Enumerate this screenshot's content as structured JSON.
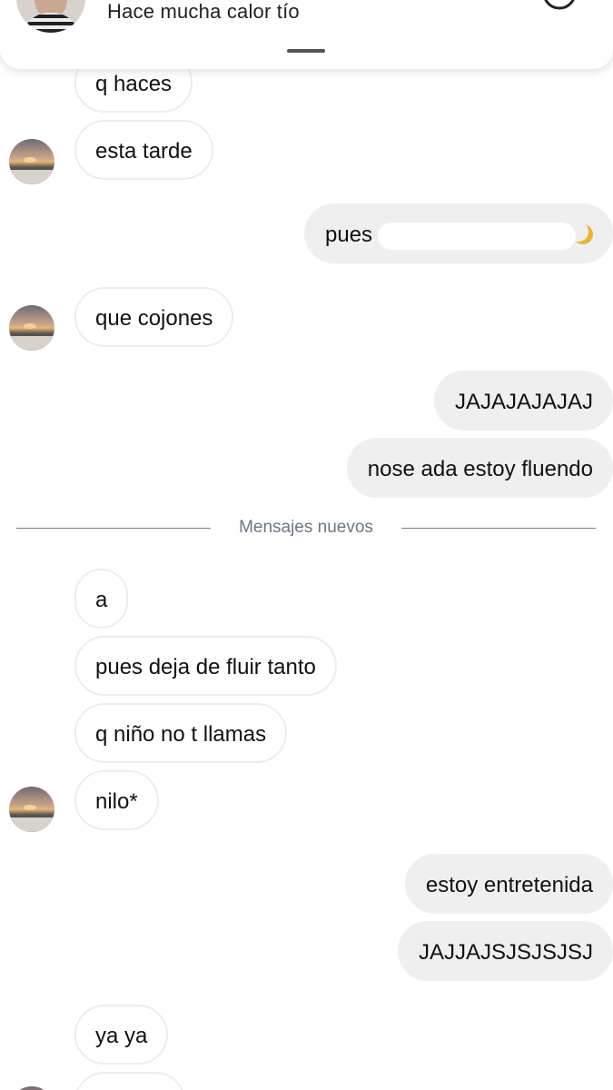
{
  "header": {
    "subtitle": "Hace mucha calor tío"
  },
  "divider": {
    "label": "Mensajes nuevos"
  },
  "messages": [
    {
      "side": "in",
      "text": "q haces"
    },
    {
      "side": "in",
      "text": "esta tarde"
    },
    {
      "side": "out",
      "text": "pues"
    },
    {
      "side": "in",
      "text": "que cojones"
    },
    {
      "side": "out",
      "text": "JAJAJAJAJAJ"
    },
    {
      "side": "out",
      "text": "nose ada estoy fluendo"
    },
    {
      "side": "in",
      "text": "a"
    },
    {
      "side": "in",
      "text": "pues deja de fluir tanto"
    },
    {
      "side": "in",
      "text": "q niño no t llamas"
    },
    {
      "side": "in",
      "text": "nilo*"
    },
    {
      "side": "out",
      "text": "estoy entretenida"
    },
    {
      "side": "out",
      "text": "JAJJAJSJSJSJSJ"
    },
    {
      "side": "in",
      "text": "ya ya"
    }
  ],
  "colors": {
    "incoming_bubble": "#ffffff",
    "incoming_border": "#ededed",
    "outgoing_bubble": "#efefef",
    "divider_text": "#6f7680",
    "moon_emoji": "#e7b43b"
  },
  "icons": [
    "sticker-face-icon",
    "crescent-moon-emoji"
  ]
}
